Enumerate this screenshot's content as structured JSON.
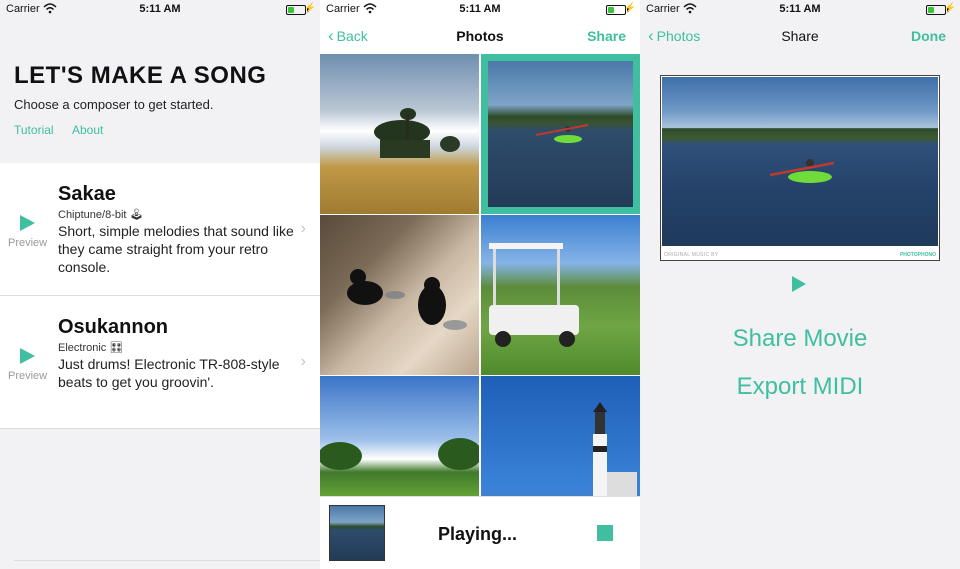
{
  "status": {
    "carrier": "Carrier",
    "time": "5:11 AM",
    "battery_level": 0.4
  },
  "colors": {
    "accent": "#3fbf9f",
    "background": "#f2f2f5",
    "text": "#111111"
  },
  "home": {
    "title": "LET'S MAKE A SONG",
    "subtitle": "Choose a composer to get started.",
    "tutorial_label": "Tutorial",
    "about_label": "About",
    "composers": [
      {
        "name": "Sakae",
        "genre": "Chiptune/8-bit 🕹",
        "description": "Short, simple melodies that sound like they came straight from your retro console.",
        "preview_label": "Preview"
      },
      {
        "name": "Osukannon",
        "genre": "Electronic 🎛",
        "description": "Just drums! Electronic TR-808-style beats to get you groovin'.",
        "preview_label": "Preview"
      }
    ]
  },
  "photos": {
    "back_label": "Back",
    "title": "Photos",
    "share_label": "Share",
    "playing_label": "Playing...",
    "icons": {
      "play": "play-icon",
      "stop": "stop-icon"
    }
  },
  "share": {
    "back_label": "Photos",
    "title": "Share",
    "done_label": "Done",
    "credit_text": "ORIGINAL MUSIC BY",
    "brand_text": "PHOTOPHONO",
    "share_movie_label": "Share Movie",
    "export_midi_label": "Export MIDI"
  }
}
